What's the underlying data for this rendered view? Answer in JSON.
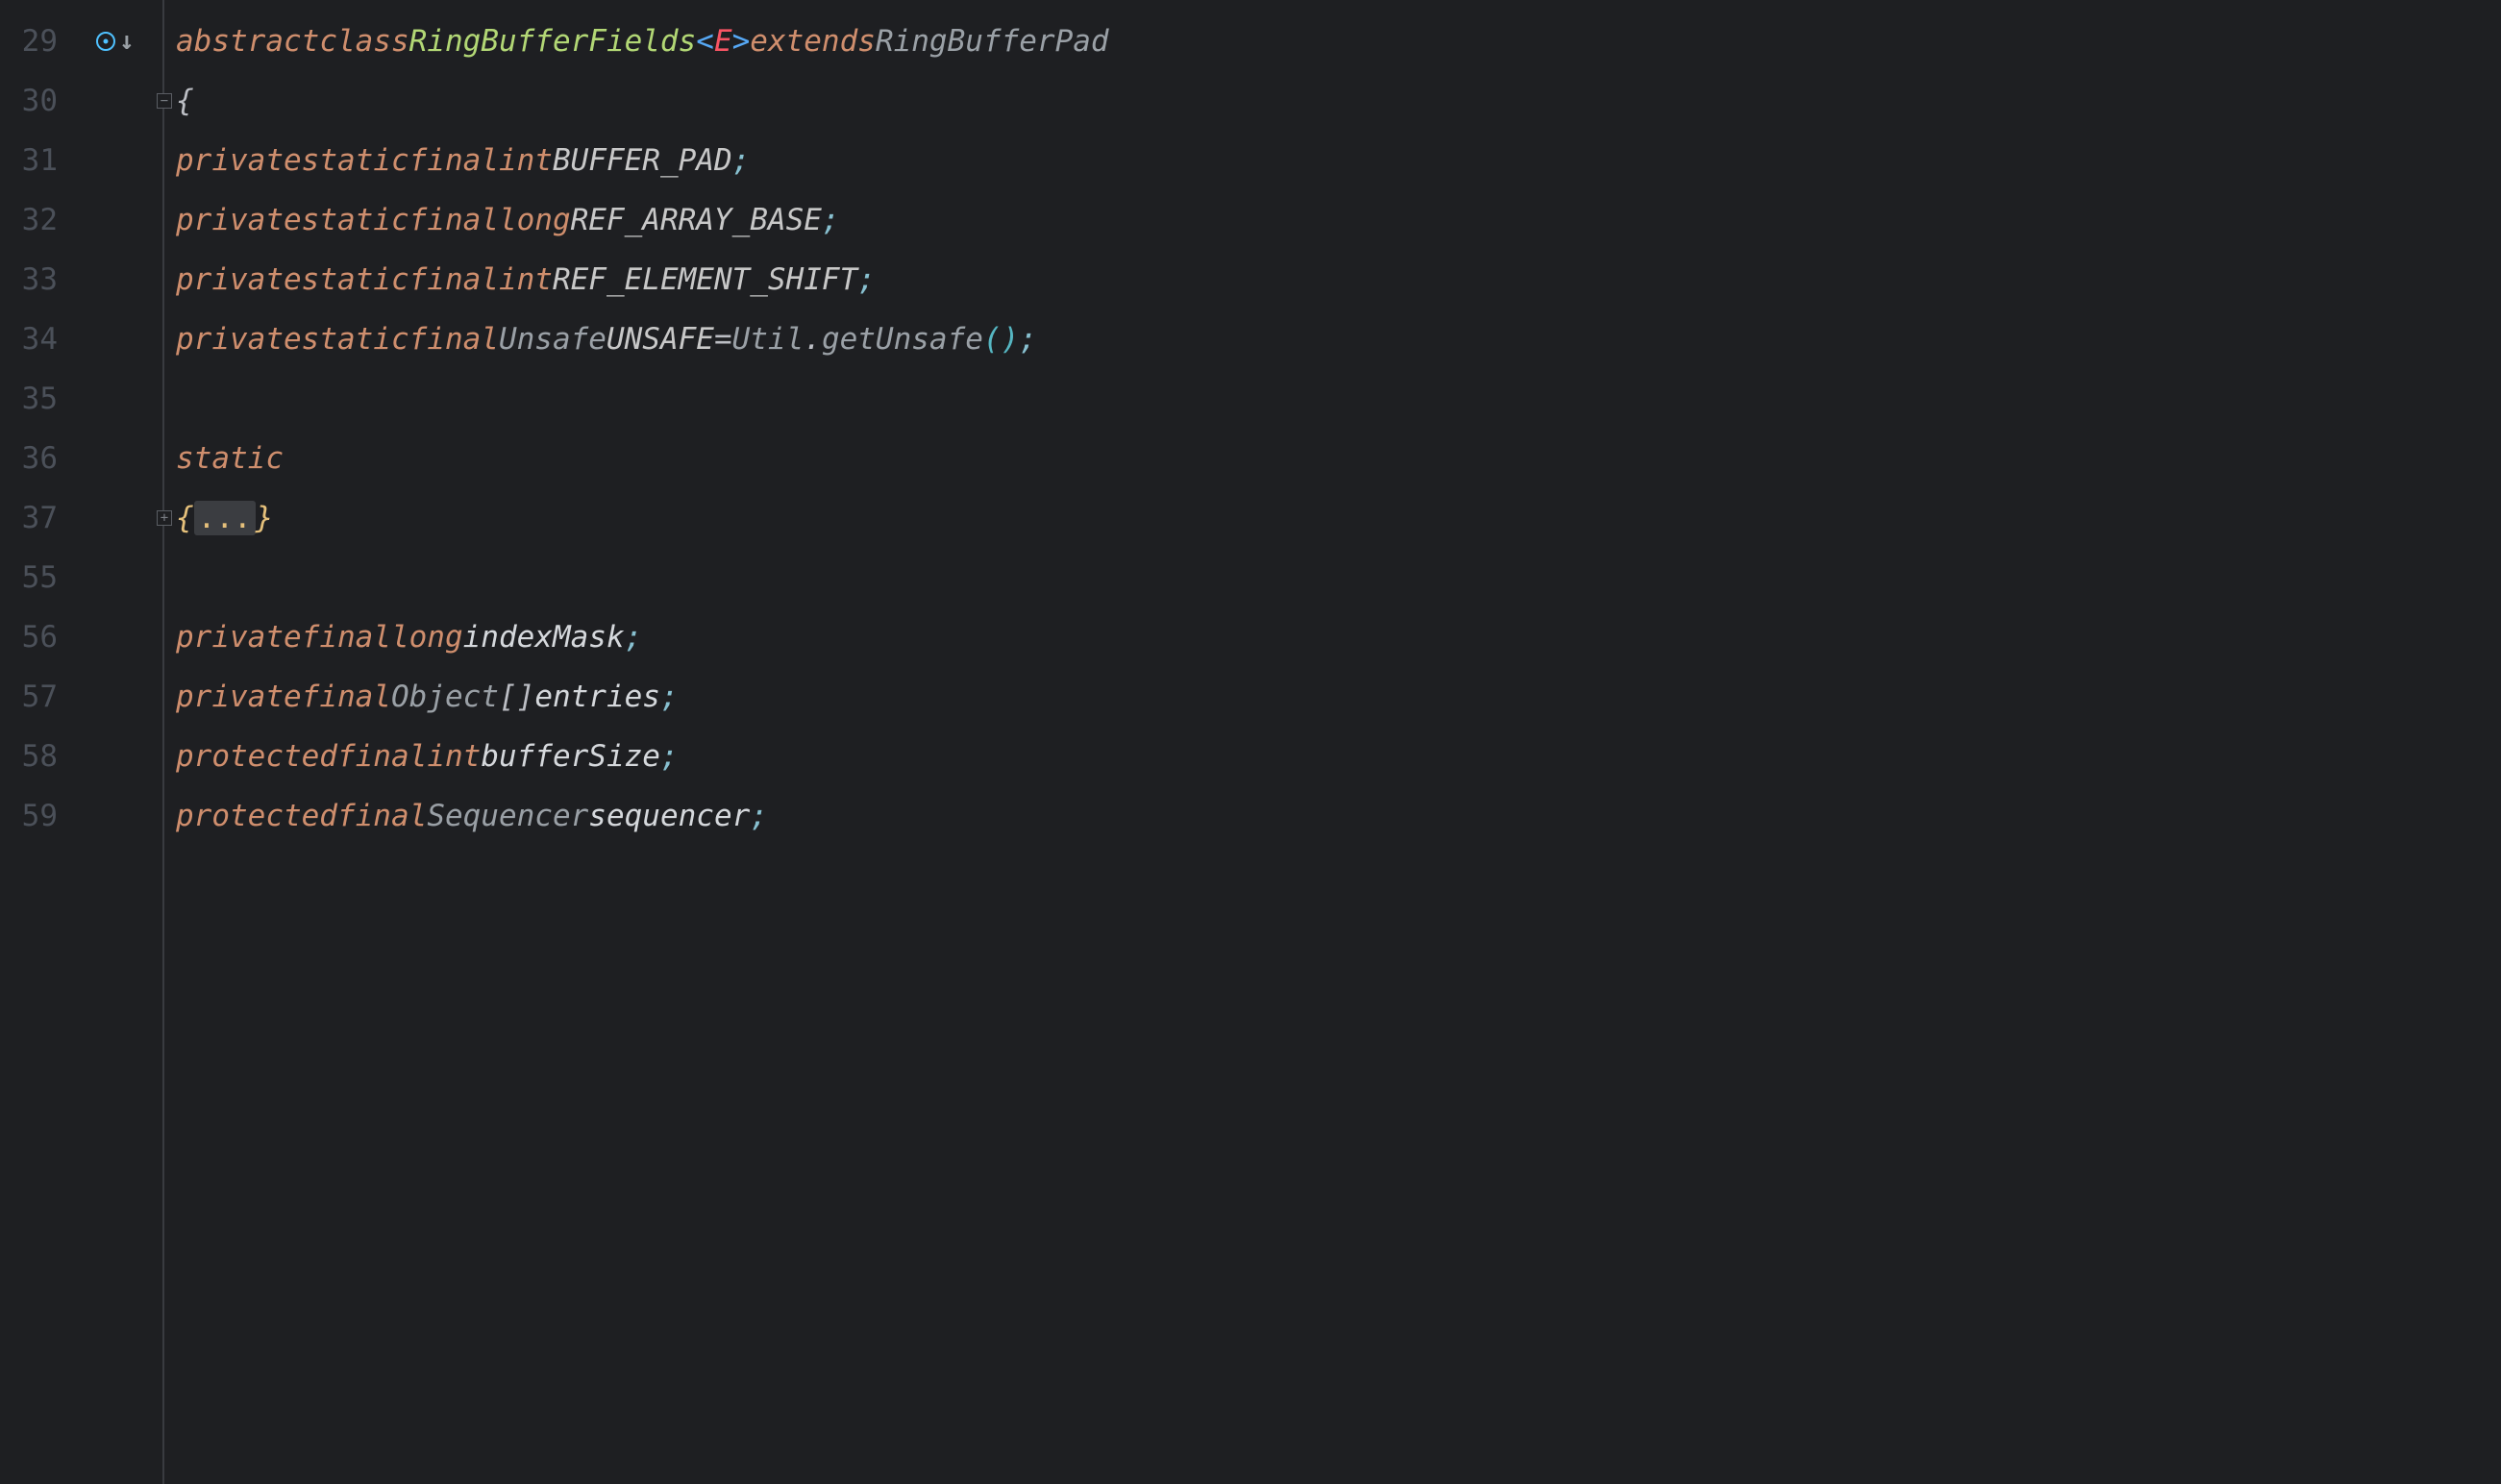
{
  "lines": {
    "l29": {
      "num": "29",
      "kw_abstract": "abstract",
      "kw_class": "class",
      "class_name": "RingBufferFields",
      "lt": "<",
      "generic": "E",
      "gt": ">",
      "kw_extends": "extends",
      "super_class": "RingBufferPad"
    },
    "l30": {
      "num": "30",
      "brace": "{"
    },
    "l31": {
      "num": "31",
      "kw_private": "private",
      "kw_static": "static",
      "kw_final": "final",
      "type": "int",
      "name": "BUFFER_PAD",
      "semi": ";"
    },
    "l32": {
      "num": "32",
      "kw_private": "private",
      "kw_static": "static",
      "kw_final": "final",
      "type": "long",
      "name": "REF_ARRAY_BASE",
      "semi": ";"
    },
    "l33": {
      "num": "33",
      "kw_private": "private",
      "kw_static": "static",
      "kw_final": "final",
      "type": "int",
      "name": "REF_ELEMENT_SHIFT",
      "semi": ";"
    },
    "l34": {
      "num": "34",
      "kw_private": "private",
      "kw_static": "static",
      "kw_final": "final",
      "type": "Unsafe",
      "name": "UNSAFE",
      "eq": "=",
      "util": "Util",
      "dot": ".",
      "method": "getUnsafe",
      "lpar": "(",
      "rpar": ")",
      "semi": ";"
    },
    "l35": {
      "num": "35"
    },
    "l36": {
      "num": "36",
      "kw_static": "static"
    },
    "l37": {
      "num": "37",
      "fold_open": "{",
      "fold_ellipsis": "...",
      "fold_close": "}"
    },
    "l55": {
      "num": "55"
    },
    "l56": {
      "num": "56",
      "kw_private": "private",
      "kw_final": "final",
      "type": "long",
      "name": "indexMask",
      "semi": ";"
    },
    "l57": {
      "num": "57",
      "kw_private": "private",
      "kw_final": "final",
      "type": "Object",
      "lbrack": "[",
      "rbrack": "]",
      "name": "entries",
      "semi": ";"
    },
    "l58": {
      "num": "58",
      "kw_protected": "protected",
      "kw_final": "final",
      "type": "int",
      "name": "bufferSize",
      "semi": ";"
    },
    "l59": {
      "num": "59",
      "kw_protected": "protected",
      "kw_final": "final",
      "type": "Sequencer",
      "name": "sequencer",
      "semi": ";"
    }
  },
  "icons": {
    "fold_minus": "−",
    "fold_plus": "+"
  }
}
